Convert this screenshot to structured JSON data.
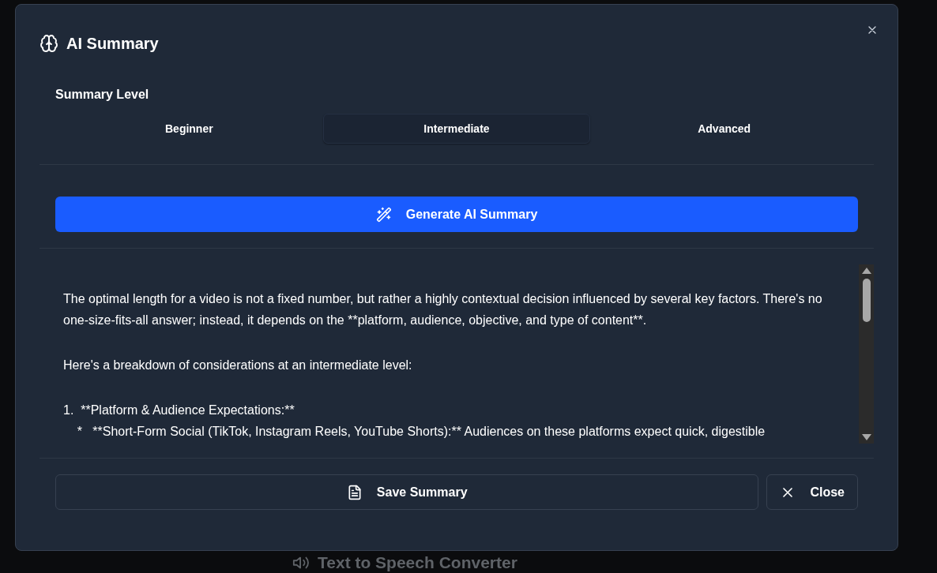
{
  "backdrop": {
    "heading": "Text to Speech Converter"
  },
  "modal": {
    "title": "AI Summary",
    "level_label": "Summary Level",
    "levels": [
      {
        "label": "Beginner",
        "selected": false
      },
      {
        "label": "Intermediate",
        "selected": true
      },
      {
        "label": "Advanced",
        "selected": false
      }
    ],
    "generate_button": "Generate AI Summary",
    "summary_paragraphs": [
      "The optimal length for a video is not a fixed number, but rather a highly contextual decision influenced by several key factors. There's no one-size-fits-all answer; instead, it depends on the **platform, audience, objective, and type of content**.",
      "Here's a breakdown of considerations at an intermediate level:",
      "1.  **Platform & Audience Expectations:**\n    *   **Short-Form Social (TikTok, Instagram Reels, YouTube Shorts):** Audiences on these platforms expect quick, digestible"
    ],
    "buttons": [
      {
        "kind": "save",
        "label": "Save Summary"
      },
      {
        "kind": "close",
        "label": "Close"
      }
    ]
  }
}
